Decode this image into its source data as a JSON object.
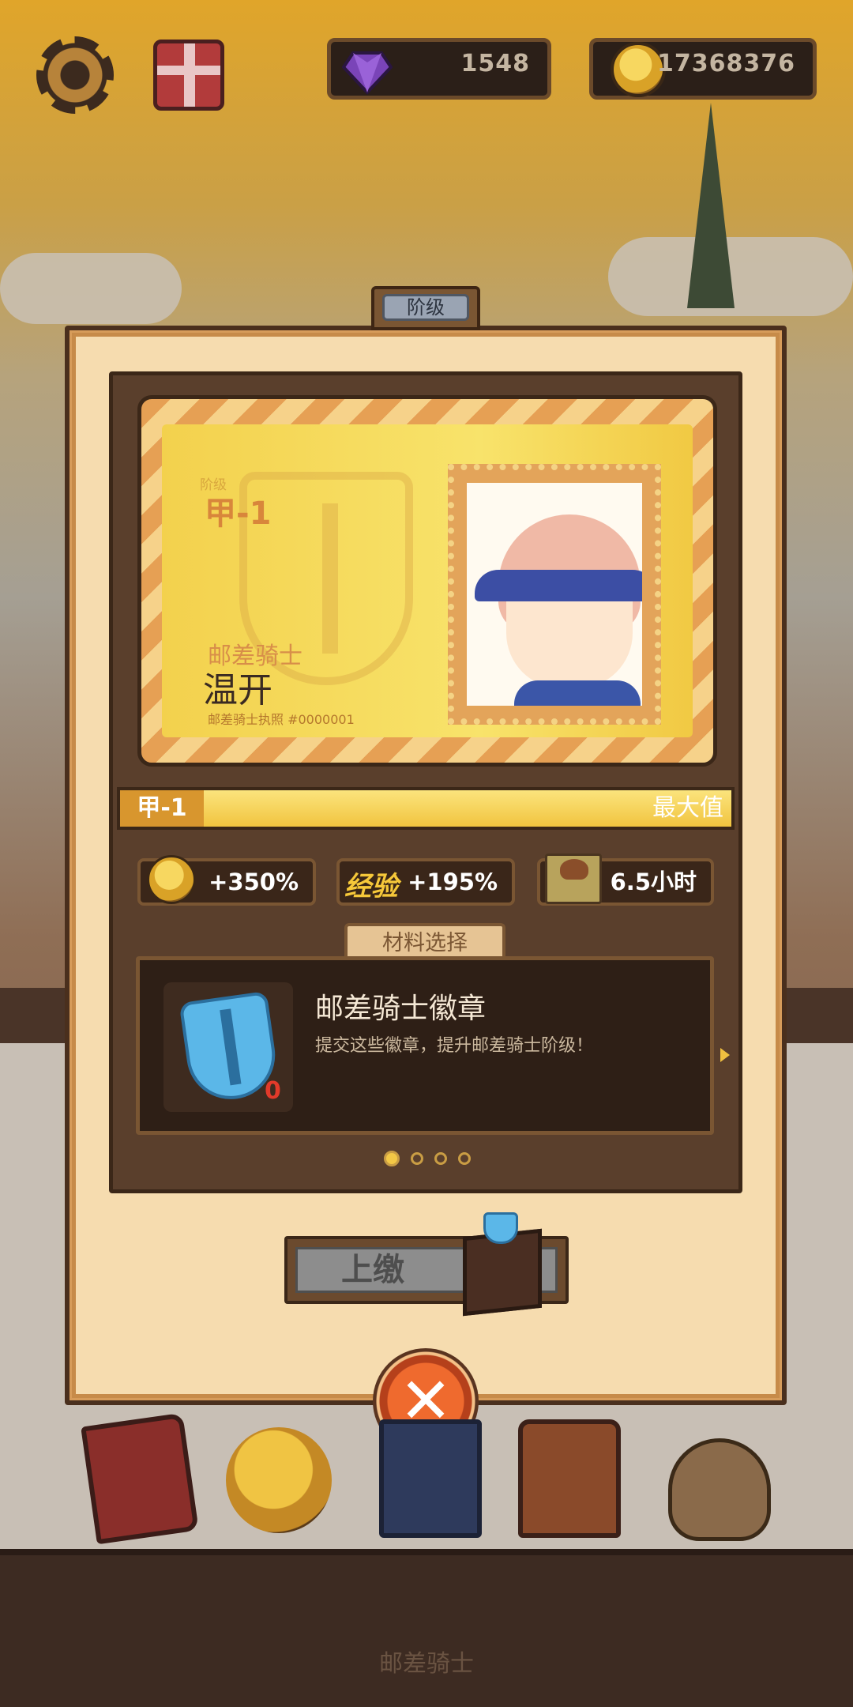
{
  "hud": {
    "gems": "1548",
    "coins": "17368376"
  },
  "panel": {
    "tab_title": "阶级",
    "card": {
      "rank_label": "阶级",
      "rank": "甲-1",
      "job_title": "邮差骑士",
      "name": "温开",
      "license": "邮差骑士执照 #0000001"
    },
    "progress": {
      "level": "甲-1",
      "max_label": "最大值",
      "fill_fraction": 1.0
    },
    "stats": [
      {
        "icon": "coin-icon",
        "value": "+350%"
      },
      {
        "icon": "exp-icon",
        "icon_text": "经验",
        "value": "+195%"
      },
      {
        "icon": "crate-icon",
        "value": "6.5小时"
      }
    ],
    "materials": {
      "tab_label": "材料选择",
      "item_title": "邮差骑士徽章",
      "item_desc": "提交这些徽章，提升邮差骑士阶级！",
      "count": "0",
      "page_count": 4,
      "current_page": 1
    },
    "submit_label": "上缴"
  },
  "bottom_nav": {
    "label": "邮差骑士",
    "items": [
      "book-icon",
      "medal-icon",
      "card-icon",
      "bag-icon",
      "treasure-icon"
    ]
  },
  "colors": {
    "panel_bg": "#f6dcaf",
    "accent_gold": "#f3c846",
    "close_orange": "#ef6a2e",
    "material_count_red": "#e23a2a"
  }
}
